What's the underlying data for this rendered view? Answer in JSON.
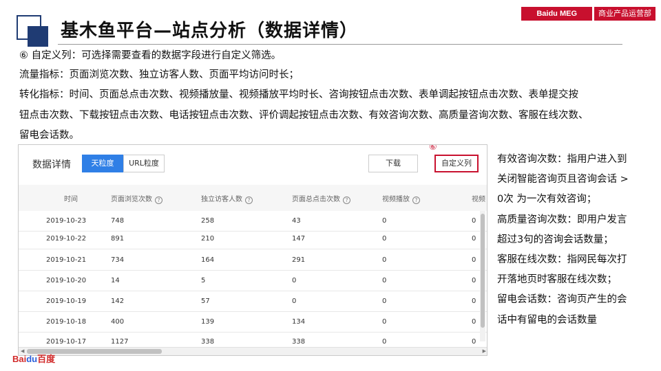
{
  "header": {
    "title": "基木鱼平台—站点分析（数据详情）",
    "brand_left": "Baidu MEG",
    "brand_right": "商业产品运营部"
  },
  "intro": {
    "line1": "⑥ 自定义列：可选择需要查看的数据字段进行自定义筛选。",
    "line2": "流量指标：页面浏览次数、独立访客人数、页面平均访问时长；",
    "line3": "转化指标：时间、页面总点击次数、视频播放量、视频播放平均时长、咨询按钮点击次数、表单调起按钮点击次数、表单提交按",
    "line4": "钮点击次数、下载按钮点击次数、电话按钮点击次数、评价调起按钮点击次数、有效咨询次数、高质量咨询次数、客服在线次数、",
    "line5": "留电会话数。"
  },
  "panel": {
    "title": "数据详情",
    "seg_day": "天粒度",
    "seg_url": "URL粒度",
    "download": "下载",
    "custom_columns": "自定义列",
    "marker": "⑥",
    "help_glyph": "?",
    "columns": [
      "时间",
      "页面浏览次数",
      "独立访客人数",
      "页面总点击次数",
      "视频播放",
      "视频"
    ],
    "rows": [
      [
        "2019-10-23",
        "748",
        "258",
        "43",
        "0",
        "0"
      ],
      [
        "2019-10-22",
        "891",
        "210",
        "147",
        "0",
        "0"
      ],
      [
        "2019-10-21",
        "734",
        "164",
        "291",
        "0",
        "0"
      ],
      [
        "2019-10-20",
        "14",
        "5",
        "0",
        "0",
        "0"
      ],
      [
        "2019-10-19",
        "142",
        "57",
        "0",
        "0",
        "0"
      ],
      [
        "2019-10-18",
        "400",
        "139",
        "134",
        "0",
        "0"
      ],
      [
        "2019-10-17",
        "1127",
        "338",
        "338",
        "0",
        "0"
      ]
    ]
  },
  "side_text": {
    "l1": "有效咨询次数：指用户进入到",
    "l2": "关闭智能咨询页且咨询会话 >",
    "l3": "0次 为一次有效咨询；",
    "l4": "高质量咨询次数：即用户发言",
    "l5": "超过3句的咨询会话数量；",
    "l6": "客服在线次数：指网民每次打",
    "l7": "开落地页时客服在线次数；",
    "l8": "留电会话数：咨询页产生的会",
    "l9": "话中有留电的会话数量"
  },
  "footer": {
    "logo_bai": "Bai",
    "logo_du": "du",
    "logo_cn": "百度"
  }
}
